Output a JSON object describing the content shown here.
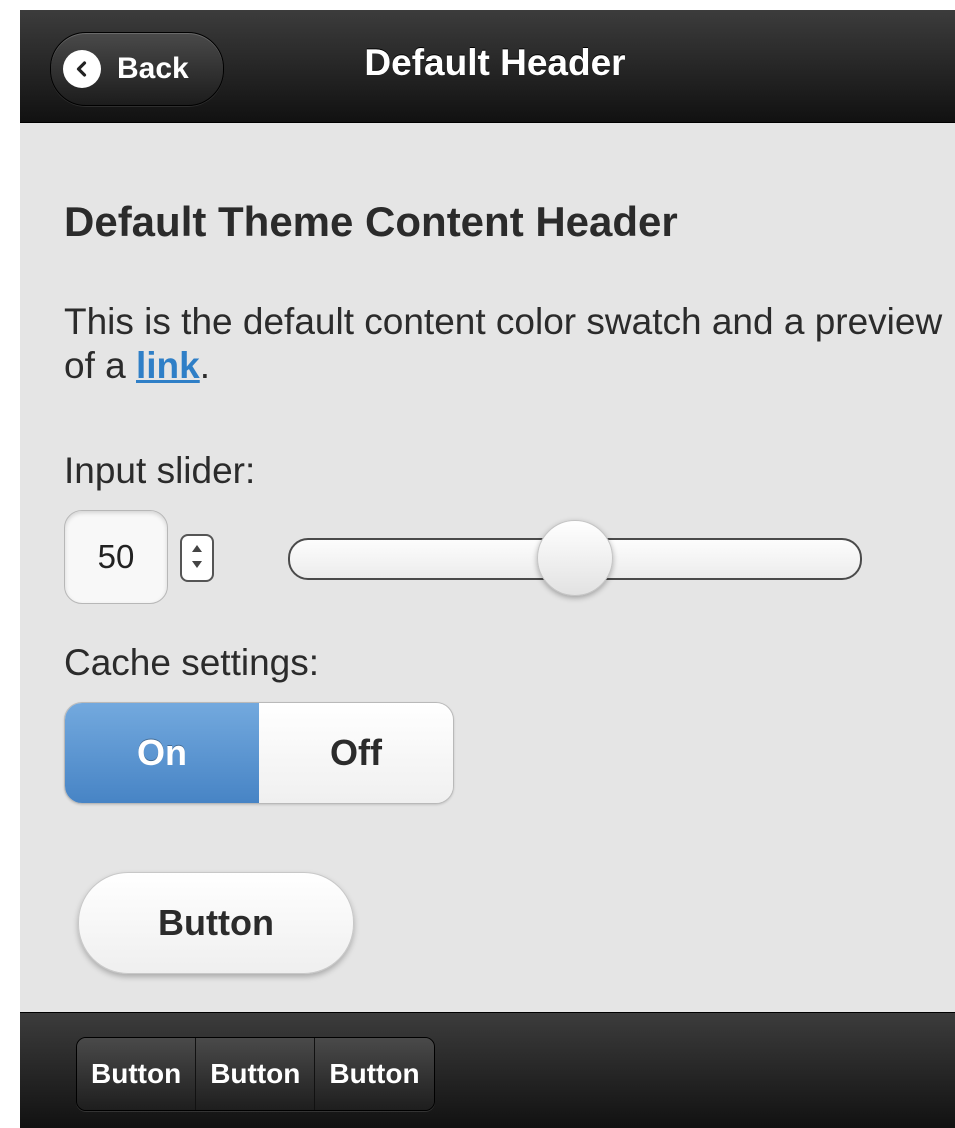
{
  "header": {
    "back_label": "Back",
    "title": "Default Header"
  },
  "content": {
    "heading": "Default Theme Content Header",
    "paragraph_text": "This is the default content color swatch and a preview of a ",
    "link_text": "link",
    "paragraph_end": "."
  },
  "slider": {
    "label": "Input slider:",
    "value": "50",
    "min": 0,
    "max": 100
  },
  "cache": {
    "label": "Cache settings:",
    "on_label": "On",
    "off_label": "Off",
    "selected": "On"
  },
  "main_button_label": "Button",
  "footer": {
    "buttons": [
      "Button",
      "Button",
      "Button"
    ]
  },
  "colors": {
    "accent": "#4784c5",
    "link": "#2f7fc7",
    "bar": "#1c1c1c",
    "body": "#e5e5e5"
  },
  "icons": {
    "back": "chevron-left-icon",
    "stepper": "spinner-arrows-icon"
  }
}
